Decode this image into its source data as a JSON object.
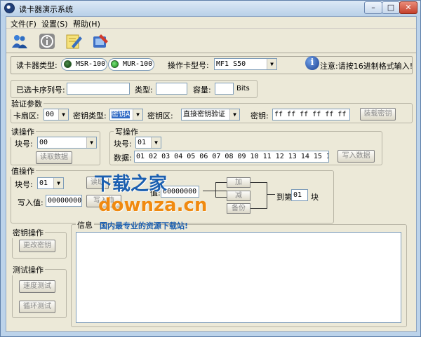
{
  "window": {
    "title": "读卡器演示系统"
  },
  "menu": [
    "文件(F)",
    "设置(S)",
    "帮助(H)"
  ],
  "toolbar_icons": [
    "users-icon",
    "info-icon",
    "edit-icon",
    "tools-icon"
  ],
  "reader": {
    "type_label": "读卡器类型:",
    "options": [
      "MSR-100",
      "MUR-100"
    ],
    "card_model_label": "操作卡型号:",
    "card_model_value": "MF1 S50",
    "notice": "注意:请按16进制格式输入!"
  },
  "selected_card": {
    "serial_label": "已选卡序列号:",
    "serial_value": "",
    "type_label": "类型:",
    "type_value": "",
    "capacity_label": "容量:",
    "capacity_value": "",
    "capacity_unit": "Bits"
  },
  "auth": {
    "title": "验证参数",
    "sector_label": "卡扇区:",
    "sector_value": "00",
    "key_type_label": "密钥类型:",
    "key_type_value": "密钥A",
    "key_area_label": "密钥区:",
    "key_area_value": "直接密钥验证",
    "key_label": "密钥:",
    "key_value": "ff ff ff ff ff ff",
    "load_key_button": "装载密钥"
  },
  "read": {
    "title": "读操作",
    "block_label": "块号:",
    "block_value": "00",
    "read_button": "读取数据"
  },
  "write": {
    "title": "写操作",
    "block_label": "块号:",
    "block_value": "01",
    "data_label": "数据:",
    "data_value": "01 02 03 04 05 06 07 08 09 10 11 12 13 14 15 16",
    "write_button": "写入数据"
  },
  "value": {
    "title": "值操作",
    "block_label": "块号:",
    "block_value": "01",
    "read_button": "读取",
    "current_label": "值:",
    "current_value": "00000000",
    "write_label": "写入值:",
    "write_value": "00000000",
    "write_button": "写入值",
    "add_button": "加",
    "sub_button": "减",
    "backup_button": "备份",
    "to_label": "到第",
    "to_value": "01",
    "block_suffix": "块"
  },
  "key_ops": {
    "title": "密钥操作",
    "change_button": "更改密钥"
  },
  "test_ops": {
    "title": "测试操作",
    "speed_button": "速度测试",
    "loop_button": "循环测试"
  },
  "info": {
    "title": "信息"
  },
  "watermark": {
    "main": "下载之家",
    "domain": "downza.cn",
    "slogan": "国内最专业的资源下载站!"
  },
  "colors": {
    "title_bg": "#bcd3ea",
    "panel_bg": "#ece9d8",
    "watermark": "#1b5fb0",
    "watermark_accent": "#f08a10"
  }
}
